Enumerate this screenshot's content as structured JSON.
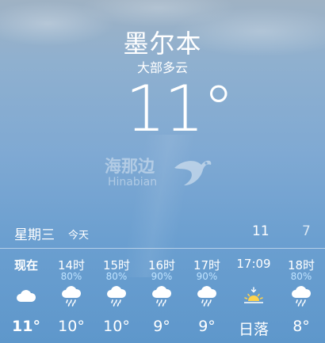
{
  "header": {
    "city": "墨尔本",
    "condition": "大部多云",
    "temperature": "11°"
  },
  "watermark": {
    "chinese": "海那边",
    "english": "Hinabian"
  },
  "forecast_day": {
    "day": "星期三",
    "label": "今天",
    "high": "11",
    "low": "7"
  },
  "hourly": [
    {
      "time": "现在",
      "precip": "",
      "icon": "cloud-icon",
      "temp": "11°"
    },
    {
      "time": "14时",
      "precip": "80%",
      "icon": "rain-cloud-icon",
      "temp": "10°"
    },
    {
      "time": "15时",
      "precip": "80%",
      "icon": "rain-cloud-icon",
      "temp": "10°"
    },
    {
      "time": "16时",
      "precip": "90%",
      "icon": "rain-cloud-icon",
      "temp": "9°"
    },
    {
      "time": "17时",
      "precip": "90%",
      "icon": "rain-cloud-icon",
      "temp": "9°"
    },
    {
      "time": "17:09",
      "precip": "",
      "icon": "sunset-icon",
      "temp": "日落"
    },
    {
      "time": "18时",
      "precip": "80%",
      "icon": "rain-cloud-icon",
      "temp": "8°"
    }
  ]
}
